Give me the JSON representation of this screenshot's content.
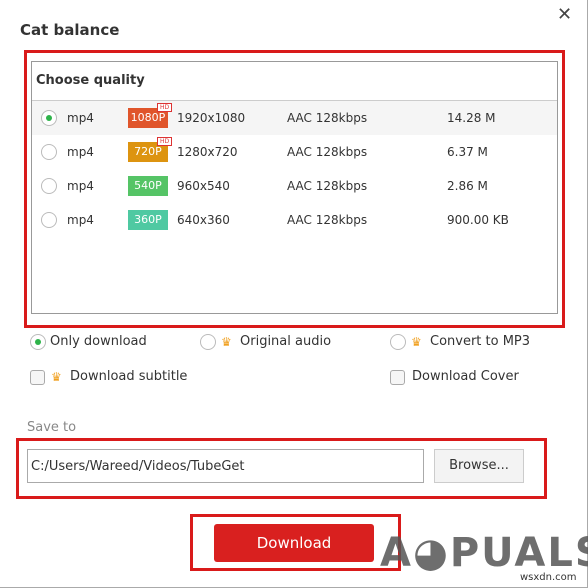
{
  "dialog": {
    "title": "Cat balance",
    "close_icon": "close-icon"
  },
  "quality": {
    "header": "Choose quality",
    "rows": [
      {
        "format": "mp4",
        "badge": "1080P",
        "badge_color": "#e0552b",
        "hd": "HD",
        "resolution": "1920x1080",
        "audio": "AAC 128kbps",
        "size": "14.28 M",
        "selected": true
      },
      {
        "format": "mp4",
        "badge": "720P",
        "badge_color": "#dd9410",
        "hd": "HD",
        "resolution": "1280x720",
        "audio": "AAC 128kbps",
        "size": "6.37 M",
        "selected": false
      },
      {
        "format": "mp4",
        "badge": "540P",
        "badge_color": "#55c466",
        "resolution": "960x540",
        "audio": "AAC 128kbps",
        "size": "2.86 M",
        "selected": false
      },
      {
        "format": "mp4",
        "badge": "360P",
        "badge_color": "#4fc9a2",
        "resolution": "640x360",
        "audio": "AAC 128kbps",
        "size": "900.00 KB",
        "selected": false
      }
    ]
  },
  "options": {
    "only_download": "Only download",
    "original_audio": "Original audio",
    "convert_mp3": "Convert to MP3",
    "download_subtitle": "Download subtitle",
    "download_cover": "Download Cover"
  },
  "save": {
    "label": "Save to",
    "path": "C:/Users/Wareed/Videos/TubeGet",
    "browse": "Browse..."
  },
  "download_label": "Download",
  "watermark": {
    "logo": "APPUALS",
    "site": "wsxdn.com"
  },
  "colors": {
    "accent": "#d9201f",
    "highlight": "#d91a1a",
    "radio_on": "#2eb34a"
  }
}
